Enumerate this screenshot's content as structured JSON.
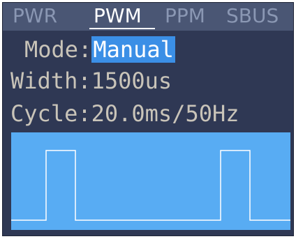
{
  "tabs": [
    {
      "label": "PWR",
      "active": false
    },
    {
      "label": "PWM",
      "active": true
    },
    {
      "label": "PPM",
      "active": false
    },
    {
      "label": "SBUS",
      "active": false
    }
  ],
  "fields": {
    "mode_label": "Mode:",
    "mode_value": "Manual",
    "width_label": "Width:",
    "width_value": "1500us",
    "cycle_label": "Cycle:",
    "cycle_value": "20.0ms/50Hz"
  },
  "colors": {
    "background": "#2f3854",
    "tab_bar": "#4a5674",
    "plot_background": "#58acf3",
    "selection": "#3b8fe6",
    "waveform": "#ffffff"
  }
}
